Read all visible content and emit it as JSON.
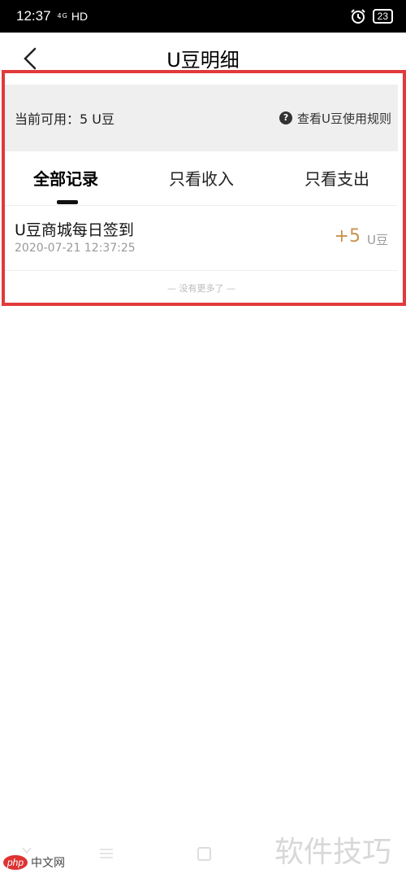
{
  "status_bar": {
    "time": "12:37",
    "signal": "4G",
    "network": "HD",
    "battery": "23"
  },
  "nav": {
    "title": "U豆明细"
  },
  "balance": {
    "text": "当前可用：5 U豆",
    "rules_link": "查看U豆使用规则"
  },
  "tabs": [
    {
      "label": "全部记录",
      "active": true
    },
    {
      "label": "只看收入",
      "active": false
    },
    {
      "label": "只看支出",
      "active": false
    }
  ],
  "records": [
    {
      "title": "U豆商城每日签到",
      "time": "2020-07-21 12:37:25",
      "amount": "+5",
      "unit": "U豆"
    }
  ],
  "footer_note": "— 没有更多了 —",
  "watermark": {
    "logo_badge": "php",
    "logo_text": "中文网",
    "text": "软件技巧"
  },
  "colors": {
    "accent_amount": "#c8924e",
    "highlight_border": "#e23a3a",
    "balance_bg": "#efefef"
  }
}
